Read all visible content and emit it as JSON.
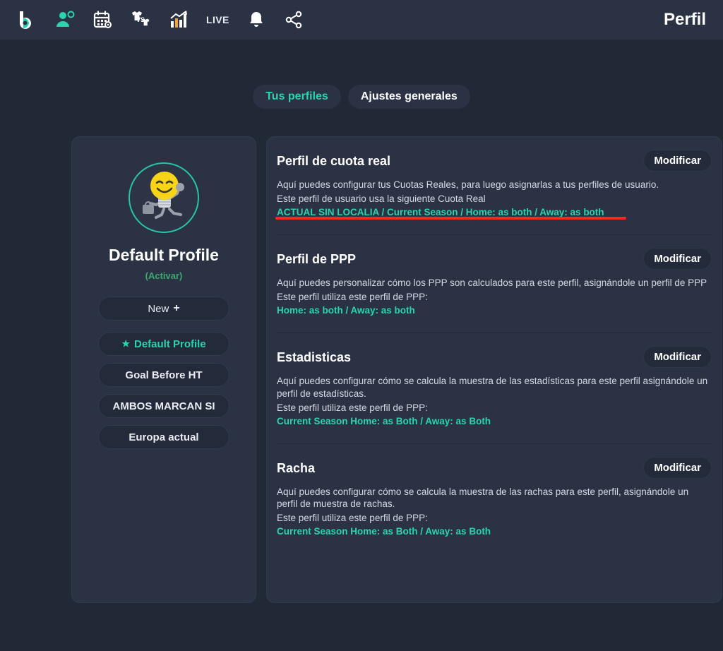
{
  "navbar": {
    "title": "Perfil",
    "items": [
      {
        "name": "logo-icon",
        "label": ""
      },
      {
        "name": "user-settings-icon",
        "label": ""
      },
      {
        "name": "calendar-settings-icon",
        "label": ""
      },
      {
        "name": "versus-shirts-icon",
        "label": ""
      },
      {
        "name": "stats-chart-icon",
        "label": ""
      },
      {
        "name": "live-label",
        "label": "LIVE"
      },
      {
        "name": "bell-icon",
        "label": ""
      },
      {
        "name": "share-icon",
        "label": ""
      }
    ]
  },
  "tabs": [
    {
      "label": "Tus perfiles",
      "active": true
    },
    {
      "label": "Ajustes generales",
      "active": false
    }
  ],
  "profile": {
    "name": "Default Profile",
    "activate_label": "(Activar)",
    "new_button": "New",
    "new_button_plus": "+",
    "profiles": [
      {
        "label": "Default Profile",
        "selected": true
      },
      {
        "label": "Goal Before HT",
        "selected": false
      },
      {
        "label": "AMBOS MARCAN SI",
        "selected": false
      },
      {
        "label": "Europa actual",
        "selected": false
      }
    ]
  },
  "sections": [
    {
      "title": "Perfil de cuota real",
      "description": "Aquí puedes configurar tus Cuotas Reales, para luego asignarlas a tus perfiles de usuario.",
      "subtitle": "Este perfil de usuario usa la siguiente Cuota Real",
      "value": "ACTUAL SIN LOCALIA / Current Season / Home: as both / Away: as both",
      "button": "Modificar",
      "annotated": true
    },
    {
      "title": "Perfil de PPP",
      "description": "Aquí puedes personalizar cómo los PPP son calculados para este perfil, asignándole un perfil de PPP",
      "subtitle": "Este perfil utiliza este perfil de PPP:",
      "value": "Home: as both / Away: as both",
      "button": "Modificar",
      "annotated": false
    },
    {
      "title": "Estadisticas",
      "description": "Aquí puedes configurar cómo se calcula la muestra de las estadísticas para este perfil asignándole un perfil de estadísticas.",
      "subtitle": "Este perfil utiliza este perfil de PPP:",
      "value": "Current Season Home: as Both / Away: as Both",
      "button": "Modificar",
      "annotated": false
    },
    {
      "title": "Racha",
      "description": "Aquí puedes configurar cómo se calcula la muestra de las rachas para este perfil, asignándole un perfil de muestra de rachas.",
      "subtitle": "Este perfil utiliza este perfil de PPP:",
      "value": "Current Season Home: as Both / Away: as Both",
      "button": "Modificar",
      "annotated": false
    }
  ],
  "colors": {
    "accent": "#2ad4b0",
    "page_bg": "#212936",
    "navbar_bg": "#2a3244",
    "card_bg": "#2a3244",
    "annotation": "#ee2b28",
    "activate_green": "#3da86f"
  }
}
